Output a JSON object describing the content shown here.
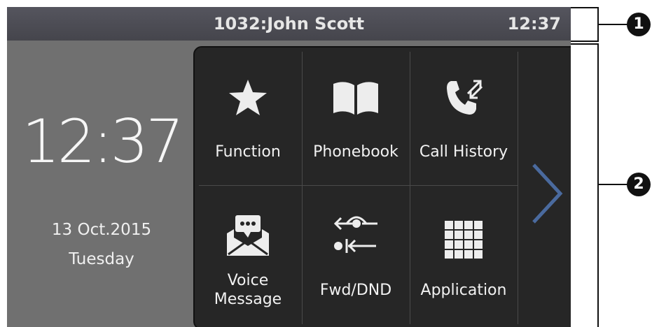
{
  "status_bar": {
    "title": "1032:John Scott",
    "time": "12:37"
  },
  "home": {
    "clock": "12:37",
    "date": "13 Oct.2015",
    "day": "Tuesday"
  },
  "menu": {
    "items": [
      {
        "label": "Function",
        "icon": "star-icon"
      },
      {
        "label": "Phonebook",
        "icon": "book-icon"
      },
      {
        "label": "Call History",
        "icon": "call-history-icon"
      },
      {
        "label": "Voice\nMessage",
        "icon": "voice-message-icon"
      },
      {
        "label": "Fwd/DND",
        "icon": "forward-dnd-icon"
      },
      {
        "label": "Application",
        "icon": "grid-icon"
      }
    ],
    "next_icon": "chevron-right-icon"
  },
  "callouts": {
    "one": "1",
    "two": "2"
  },
  "colors": {
    "panel": "#262626",
    "screen": "#707070",
    "status_bar": "#4d4d55",
    "arrow": "#4a6a9e"
  }
}
